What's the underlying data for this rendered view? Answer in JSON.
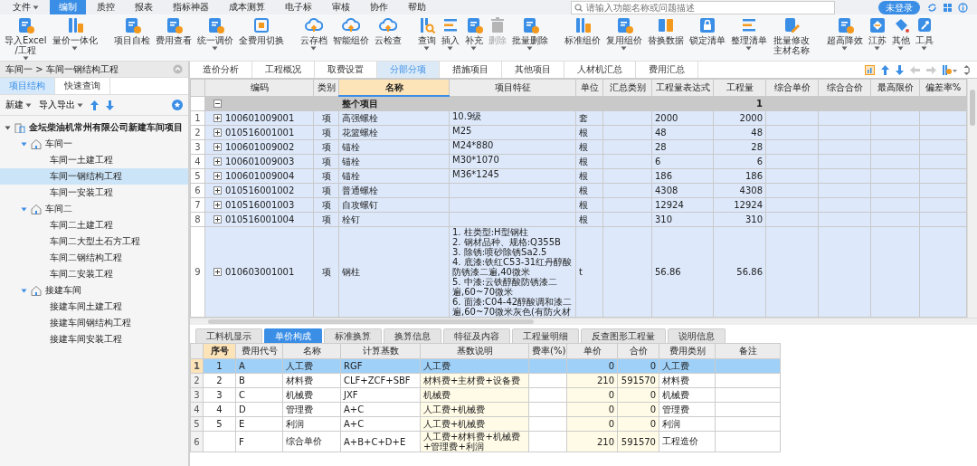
{
  "menu": [
    {
      "label": "文件",
      "dropdown": true,
      "selected": false
    },
    {
      "label": "编制",
      "dropdown": false,
      "selected": true
    },
    {
      "label": "质控",
      "dropdown": false,
      "selected": false
    },
    {
      "label": "报表",
      "dropdown": false,
      "selected": false
    },
    {
      "label": "指标神器",
      "dropdown": false,
      "selected": false
    },
    {
      "label": "成本测算",
      "dropdown": false,
      "selected": false
    },
    {
      "label": "电子标",
      "dropdown": false,
      "selected": false
    },
    {
      "label": "审核",
      "dropdown": false,
      "selected": false
    },
    {
      "label": "协作",
      "dropdown": false,
      "selected": false
    },
    {
      "label": "帮助",
      "dropdown": false,
      "selected": false
    }
  ],
  "search": {
    "placeholder": "请输入功能名称或问题描述"
  },
  "login_button": "未登录",
  "toolbar_groups": [
    [
      {
        "label": "导入Excel\n/工程",
        "dropdown": true,
        "disabled": false
      },
      {
        "label": "量价一体化",
        "dropdown": true,
        "disabled": false
      }
    ],
    [
      {
        "label": "项目自检",
        "dropdown": false,
        "disabled": false
      },
      {
        "label": "费用查看",
        "dropdown": false,
        "disabled": false
      },
      {
        "label": "统一调价",
        "dropdown": true,
        "disabled": false
      },
      {
        "label": "全费用切换",
        "dropdown": false,
        "disabled": false
      }
    ],
    [
      {
        "label": "云存档",
        "dropdown": true,
        "disabled": false
      },
      {
        "label": "智能组价",
        "dropdown": false,
        "disabled": false
      },
      {
        "label": "云检查",
        "dropdown": false,
        "disabled": false
      }
    ],
    [
      {
        "label": "查询",
        "dropdown": true,
        "disabled": false
      },
      {
        "label": "插入",
        "dropdown": true,
        "disabled": false
      },
      {
        "label": "补充",
        "dropdown": true,
        "disabled": false
      },
      {
        "label": "删除",
        "dropdown": false,
        "disabled": true
      },
      {
        "label": "批量删除",
        "dropdown": true,
        "disabled": false
      }
    ],
    [
      {
        "label": "标准组价",
        "dropdown": false,
        "disabled": false
      },
      {
        "label": "复用组价",
        "dropdown": true,
        "disabled": false
      },
      {
        "label": "替换数据",
        "dropdown": false,
        "disabled": false
      },
      {
        "label": "锁定清单",
        "dropdown": false,
        "disabled": false
      },
      {
        "label": "整理清单",
        "dropdown": true,
        "disabled": false
      },
      {
        "label": "批量修改主材名称",
        "dropdown": false,
        "disabled": false
      }
    ],
    [
      {
        "label": "超高降效",
        "dropdown": true,
        "disabled": false
      },
      {
        "label": "江苏",
        "dropdown": true,
        "disabled": false
      },
      {
        "label": "其他",
        "dropdown": true,
        "disabled": false
      },
      {
        "label": "工具",
        "dropdown": true,
        "disabled": false
      }
    ]
  ],
  "breadcrumb": "车间一 > 车间一钢结构工程",
  "left_tabs": [
    {
      "label": "项目结构",
      "selected": true
    },
    {
      "label": "快速查询",
      "selected": false
    }
  ],
  "left_toolbar": [
    {
      "label": "新建",
      "dropdown": true
    },
    {
      "label": "导入导出",
      "dropdown": true
    }
  ],
  "tree": [
    {
      "label": "金坛柴油机常州有限公司新建车间项目",
      "expanded": true,
      "selected": false,
      "children": [
        {
          "label": "车间一",
          "expanded": true,
          "selected": false,
          "children": [
            {
              "label": "车间一土建工程",
              "selected": false
            },
            {
              "label": "车间一钢结构工程",
              "selected": true
            },
            {
              "label": "车间一安装工程",
              "selected": false
            }
          ]
        },
        {
          "label": "车间二",
          "expanded": true,
          "selected": false,
          "children": [
            {
              "label": "车间二土建工程",
              "selected": false
            },
            {
              "label": "车间二大型土石方工程",
              "selected": false
            },
            {
              "label": "车间二钢结构工程",
              "selected": false
            },
            {
              "label": "车间二安装工程",
              "selected": false
            }
          ]
        },
        {
          "label": "接建车间",
          "expanded": true,
          "selected": false,
          "children": [
            {
              "label": "接建车间土建工程",
              "selected": false
            },
            {
              "label": "接建车间钢结构工程",
              "selected": false
            },
            {
              "label": "接建车间安装工程",
              "selected": false
            }
          ]
        }
      ]
    }
  ],
  "main_tabs": [
    {
      "label": "造价分析",
      "selected": false
    },
    {
      "label": "工程概况",
      "selected": false
    },
    {
      "label": "取费设置",
      "selected": false
    },
    {
      "label": "分部分项",
      "selected": true
    },
    {
      "label": "措施项目",
      "selected": false
    },
    {
      "label": "其他项目",
      "selected": false
    },
    {
      "label": "人材机汇总",
      "selected": false
    },
    {
      "label": "费用汇总",
      "selected": false
    }
  ],
  "main_table": {
    "columns": [
      {
        "label": "编码",
        "selected": false
      },
      {
        "label": "类别",
        "selected": false
      },
      {
        "label": "名称",
        "selected": true
      },
      {
        "label": "项目特征",
        "selected": false
      },
      {
        "label": "单位",
        "selected": false
      },
      {
        "label": "汇总类别",
        "selected": false
      },
      {
        "label": "工程量表达式",
        "selected": false
      },
      {
        "label": "工程量",
        "selected": false
      },
      {
        "label": "综合单价",
        "selected": false
      },
      {
        "label": "综合合价",
        "selected": false
      },
      {
        "label": "最高限价",
        "selected": false
      },
      {
        "label": "偏差率%",
        "selected": false
      }
    ],
    "rows": [
      {
        "kind": "section",
        "expanded": true,
        "name": "整个项目",
        "quantity": "1"
      },
      {
        "kind": "item",
        "number": "1",
        "expanded": false,
        "code": "100601009001",
        "type": "项",
        "name": "高强螺栓",
        "feature": "10.9级",
        "unit": "套",
        "expression": "2000",
        "quantity": "2000"
      },
      {
        "kind": "item",
        "number": "2",
        "expanded": false,
        "code": "010516001001",
        "type": "项",
        "name": "花篮螺栓",
        "feature": "M25",
        "unit": "根",
        "expression": "48",
        "quantity": "48"
      },
      {
        "kind": "item",
        "number": "3",
        "expanded": false,
        "code": "100601009002",
        "type": "项",
        "name": "锚栓",
        "feature": "M24*880",
        "unit": "根",
        "expression": "28",
        "quantity": "28"
      },
      {
        "kind": "item",
        "number": "4",
        "expanded": false,
        "code": "100601009003",
        "type": "项",
        "name": "锚栓",
        "feature": "M30*1070",
        "unit": "根",
        "expression": "6",
        "quantity": "6"
      },
      {
        "kind": "item",
        "number": "5",
        "expanded": false,
        "code": "100601009004",
        "type": "项",
        "name": "锚栓",
        "feature": "M36*1245",
        "unit": "根",
        "expression": "186",
        "quantity": "186"
      },
      {
        "kind": "item",
        "number": "6",
        "expanded": false,
        "code": "010516001002",
        "type": "项",
        "name": "普通螺栓",
        "unit": "根",
        "expression": "4308",
        "quantity": "4308"
      },
      {
        "kind": "item",
        "number": "7",
        "expanded": false,
        "code": "010516001003",
        "type": "项",
        "name": "自攻螺钉",
        "unit": "根",
        "expression": "12924",
        "quantity": "12924"
      },
      {
        "kind": "item",
        "number": "8",
        "expanded": false,
        "code": "010516001004",
        "type": "项",
        "name": "栓钉",
        "unit": "根",
        "expression": "310",
        "quantity": "310"
      },
      {
        "kind": "item",
        "number": "9",
        "expanded": false,
        "code": "010603001001",
        "type": "项",
        "name": "钢柱",
        "feature": "1. 柱类型:H型钢柱\n2. 钢材品种、规格:Q355B\n3. 除锈:喷砂除锈Sa2.5\n4. 底漆:铁红C53-31红丹醇酸防锈漆二遍,40微米\n5. 中漆:云铁醇酸防锈漆二遍,60~70微米\n6. 面漆:C04-42醇酸调和漆二遍,60~70微米灰色(有防火材",
        "unit": "t",
        "expression": "56.86",
        "quantity": "56.86"
      }
    ]
  },
  "detail_tabs": [
    {
      "label": "工料机显示",
      "selected": false
    },
    {
      "label": "单价构成",
      "selected": true
    },
    {
      "label": "标准换算",
      "selected": false
    },
    {
      "label": "换算信息",
      "selected": false
    },
    {
      "label": "特征及内容",
      "selected": false
    },
    {
      "label": "工程量明细",
      "selected": false
    },
    {
      "label": "反查图形工程量",
      "selected": false
    },
    {
      "label": "说明信息",
      "selected": false
    }
  ],
  "detail_table": {
    "columns": [
      {
        "label": "序号",
        "selected": true
      },
      {
        "label": "费用代号",
        "selected": false
      },
      {
        "label": "名称",
        "selected": false
      },
      {
        "label": "计算基数",
        "selected": false
      },
      {
        "label": "基数说明",
        "selected": false
      },
      {
        "label": "费率(%)",
        "selected": false
      },
      {
        "label": "单价",
        "selected": false
      },
      {
        "label": "合价",
        "selected": false
      },
      {
        "label": "费用类别",
        "selected": false
      },
      {
        "label": "备注",
        "selected": false
      }
    ],
    "rows": [
      {
        "number": "1",
        "selected": true,
        "seq": "1",
        "code": "A",
        "name": "人工费",
        "base": "RGF",
        "base_desc": "人工费",
        "unit_price": "0",
        "total": "0",
        "category": "人工费"
      },
      {
        "number": "2",
        "selected": false,
        "seq": "2",
        "code": "B",
        "name": "材料费",
        "base": "CLF+ZCF+SBF",
        "base_desc": "材料费+主材费+设备费",
        "unit_price": "210",
        "total": "591570",
        "category": "材料费"
      },
      {
        "number": "3",
        "selected": false,
        "seq": "3",
        "code": "C",
        "name": "机械费",
        "base": "JXF",
        "base_desc": "机械费",
        "unit_price": "0",
        "total": "0",
        "category": "机械费"
      },
      {
        "number": "4",
        "selected": false,
        "seq": "4",
        "code": "D",
        "name": "管理费",
        "base": "A+C",
        "base_desc": "人工费+机械费",
        "unit_price": "0",
        "total": "0",
        "category": "管理费"
      },
      {
        "number": "5",
        "selected": false,
        "seq": "5",
        "code": "E",
        "name": "利润",
        "base": "A+C",
        "base_desc": "人工费+机械费",
        "unit_price": "0",
        "total": "0",
        "category": "利润"
      },
      {
        "number": "6",
        "selected": false,
        "code": "F",
        "name": "综合单价",
        "base": "A+B+C+D+E",
        "base_desc": "人工费+材料费+机械费+管理费+利润",
        "unit_price": "210",
        "total": "591570",
        "category": "工程造价"
      }
    ]
  }
}
